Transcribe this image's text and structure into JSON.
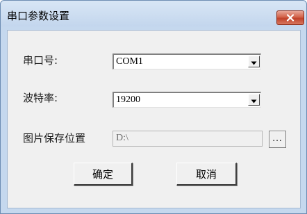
{
  "window": {
    "title": "串口参数设置"
  },
  "form": {
    "port": {
      "label": "串口号:",
      "value": "COM1"
    },
    "baud": {
      "label": "波特率:",
      "value": "19200"
    },
    "path": {
      "label": "图片保存位置",
      "value": "D:\\"
    },
    "browse_label": "..."
  },
  "buttons": {
    "ok": "确定",
    "cancel": "取消"
  },
  "colors": {
    "frame": "#c5d8ee",
    "client": "#f0f0f0",
    "close_button": "#c9503a"
  },
  "icons": {
    "close": "close-x-icon",
    "dropdown": "dropdown-arrow-icon"
  }
}
